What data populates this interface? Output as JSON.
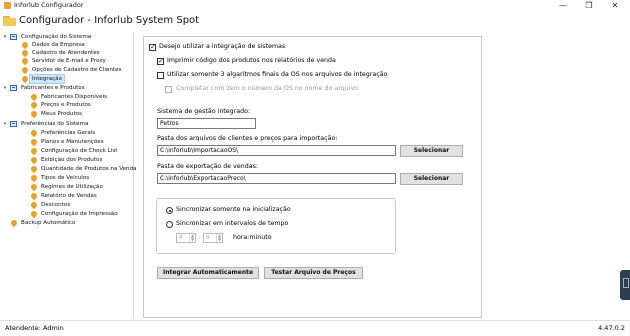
{
  "window": {
    "titlebar_title": "Inforlub Configurador",
    "app_title": "Configurador - Inforlub System Spot",
    "controls": {
      "minimize": "—",
      "restore": "❐",
      "close": "✕"
    }
  },
  "tree": {
    "items": [
      {
        "label": "Configuração do Sistema",
        "kind": "group",
        "expander": "▾"
      },
      {
        "label": "Dados da Empresa",
        "kind": "leaf"
      },
      {
        "label": "Cadastro de Atendentes",
        "kind": "leaf"
      },
      {
        "label": "Servidor de E-mail e Proxy",
        "kind": "leaf"
      },
      {
        "label": "Opções de Cadastro de Clientes",
        "kind": "leaf"
      },
      {
        "label": "Integração",
        "kind": "leaf",
        "selected": true
      },
      {
        "label": "Fabricantes e Produtos",
        "kind": "group",
        "expander": "▾"
      },
      {
        "label": "Fabricantes Disponíveis",
        "kind": "leaf"
      },
      {
        "label": "Preços e Produtos",
        "kind": "leaf"
      },
      {
        "label": "Meus Produtos",
        "kind": "leaf"
      },
      {
        "label": "Preferências do Sistema",
        "kind": "group",
        "expander": "▾"
      },
      {
        "label": "Preferências Gerais",
        "kind": "leaf"
      },
      {
        "label": "Planos e Manutenções",
        "kind": "leaf"
      },
      {
        "label": "Configuração de Check List",
        "kind": "leaf"
      },
      {
        "label": "Exibição dos Produtos",
        "kind": "leaf"
      },
      {
        "label": "Quantidade de Produtos na Venda",
        "kind": "leaf"
      },
      {
        "label": "Tipos de Veículos",
        "kind": "leaf"
      },
      {
        "label": "Regimes de Utilização",
        "kind": "leaf"
      },
      {
        "label": "Relatório de Vendas",
        "kind": "leaf"
      },
      {
        "label": "Descontos",
        "kind": "leaf"
      },
      {
        "label": "Configuração de Impressão",
        "kind": "leaf"
      },
      {
        "label": "Backup Automático",
        "kind": "leaf"
      }
    ]
  },
  "integration": {
    "enable_label": "Desejo utilizar a integração de sistemas",
    "enable_checked": true,
    "print_code_label": "Imprimir código dos produtos nos relatórios de venda",
    "print_code_checked": true,
    "last3_label": "Utilizar somente 3 algarítmos finais da OS nos arquivos de integração",
    "last3_checked": false,
    "complete_zero_label": "Completar com zero o número da OS no nome do arquivo",
    "complete_zero_checked": false,
    "system_label": "Sistema de gestão integrado:",
    "system_value": "Petros",
    "import_label": "Pasta dos arquivos de clientes e preços para importação:",
    "import_value": "C:\\inforlub\\ImportacaoOS\\",
    "export_label": "Pasta de exportação de vendas:",
    "export_value": "C:\\inforlub\\ExportacaoPreco\\",
    "select_button": "Selecionar",
    "sync_startup_label": "Sincronizar somente na inicialização",
    "sync_interval_label": "Sincronizar em intervalos de tempo",
    "sync_mode": "startup",
    "hours_value": "0",
    "minutes_value": "0",
    "time_separator": ":",
    "time_unit_label": "hora:minuto",
    "integrate_button": "Integrar Automaticamente",
    "test_button": "Testar Arquivo de Preços"
  },
  "status": {
    "user": "Atendente: Admin",
    "version": "4.47.0.2"
  },
  "colors": {
    "selection_bg": "#cce8ff",
    "tree_group_icon": "#2d6db5",
    "tree_leaf_icon": "#e3a32c"
  }
}
